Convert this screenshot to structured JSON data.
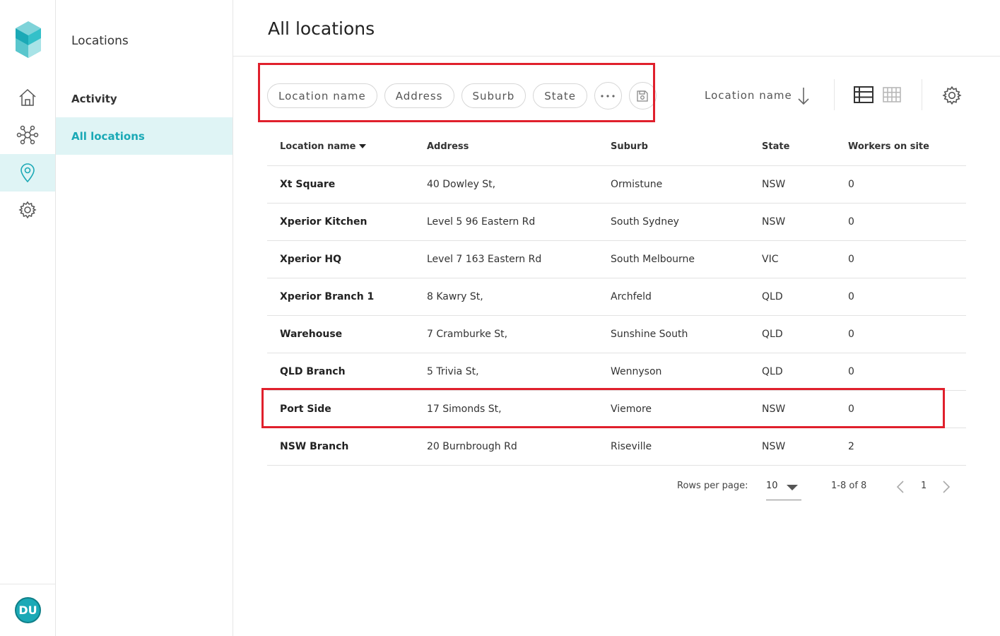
{
  "rail": {
    "avatar_initials": "DU",
    "brand_color": "#1ba9b6"
  },
  "subnav": {
    "title": "Locations",
    "items": [
      {
        "label": "Activity",
        "active": false
      },
      {
        "label": "All locations",
        "active": true
      }
    ]
  },
  "page": {
    "title": "All locations"
  },
  "filters": {
    "chips": [
      "Location name",
      "Address",
      "Suburb",
      "State"
    ]
  },
  "sort": {
    "label": "Location name"
  },
  "table": {
    "columns": [
      "Location name",
      "Address",
      "Suburb",
      "State",
      "Workers on site"
    ],
    "rows": [
      {
        "name": "Xt Square",
        "address": "40 Dowley St,",
        "suburb": "Ormistune",
        "state": "NSW",
        "workers": "0"
      },
      {
        "name": "Xperior Kitchen",
        "address": "Level 5 96 Eastern Rd",
        "suburb": "South Sydney",
        "state": "NSW",
        "workers": "0"
      },
      {
        "name": "Xperior HQ",
        "address": "Level 7 163 Eastern Rd",
        "suburb": "South Melbourne",
        "state": "VIC",
        "workers": "0"
      },
      {
        "name": "Xperior Branch 1",
        "address": "8 Kawry St,",
        "suburb": "Archfeld",
        "state": "QLD",
        "workers": "0"
      },
      {
        "name": "Warehouse",
        "address": "7 Cramburke St,",
        "suburb": "Sunshine South",
        "state": "QLD",
        "workers": "0"
      },
      {
        "name": "QLD Branch",
        "address": "5 Trivia St,",
        "suburb": "Wennyson",
        "state": "QLD",
        "workers": "0"
      },
      {
        "name": "Port Side",
        "address": "17 Simonds St,",
        "suburb": "Viemore",
        "state": "NSW",
        "workers": "0"
      },
      {
        "name": "NSW Branch",
        "address": "20 Burnbrough Rd",
        "suburb": "Riseville",
        "state": "NSW",
        "workers": "2"
      }
    ]
  },
  "pagination": {
    "rows_per_page_label": "Rows per page:",
    "rows_per_page_value": "10",
    "range_text": "1-8 of 8",
    "current_page": "1"
  },
  "colors": {
    "highlight": "#e0202c",
    "active_bg": "#dff4f5"
  }
}
